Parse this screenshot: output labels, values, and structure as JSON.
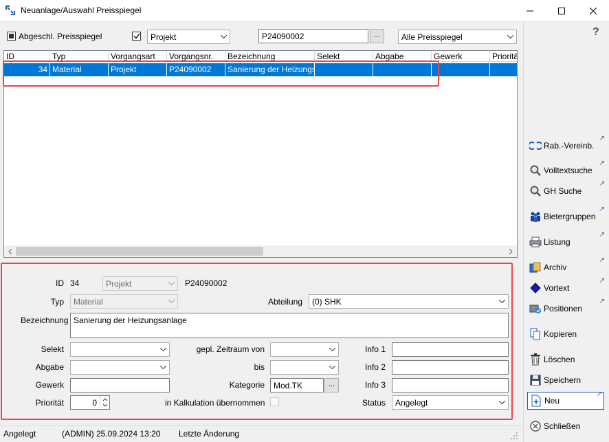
{
  "window": {
    "title": "Neuanlage/Auswahl Preisspiegel"
  },
  "toolbar": {
    "closed_checkbox_label": "Abgeschl. Preisspiegel",
    "type_combo": "Projekt",
    "search_value": "P24090002",
    "dots_label": "...",
    "filter_combo": "Alle Preisspiegel",
    "help_label": "?"
  },
  "grid": {
    "columns": [
      "ID",
      "Typ",
      "Vorgangsart",
      "Vorgangsnr.",
      "Bezeichnung",
      "Selekt",
      "Abgabe",
      "Gewerk",
      "Prioritä"
    ],
    "rows": [
      {
        "id": "34",
        "typ": "Material",
        "vorgangsart": "Projekt",
        "vorgangsnr": "P24090002",
        "bezeichnung": "Sanierung der Heizungsa",
        "selekt": "",
        "abgabe": "",
        "gewerk": "",
        "prioritaet": ""
      }
    ]
  },
  "form": {
    "id_label": "ID",
    "id_value": "34",
    "vorgangsart": "Projekt",
    "vorgangsnr": "P24090002",
    "typ_label": "Typ",
    "typ_value": "Material",
    "abteilung_label": "Abteilung",
    "abteilung_value": "(0) SHK",
    "bezeichnung_label": "Bezeichnung",
    "bezeichnung_value": "Sanierung der Heizungsanlage",
    "selekt_label": "Selekt",
    "abgabe_label": "Abgabe",
    "gewerk_label": "Gewerk",
    "prioritaet_label": "Priorität",
    "prioritaet_value": "0",
    "zeitraum_von_label": "gepl. Zeitraum von",
    "bis_label": "bis",
    "kategorie_label": "Kategorie",
    "kategorie_value": "Mod.TK",
    "kalkulation_label": "in Kalkulation übernommen",
    "info1_label": "Info 1",
    "info2_label": "Info 2",
    "info3_label": "Info 3",
    "status_label": "Status",
    "status_value": "Angelegt"
  },
  "sidebar": {
    "items": [
      {
        "label": "Rab.-Vereinb.",
        "icon": "euro-icon"
      },
      {
        "label": "Volltextsuche",
        "icon": "magnifier-icon"
      },
      {
        "label": "GH Suche",
        "icon": "magnifier-icon"
      },
      {
        "label": "Bietergruppen",
        "icon": "group-icon"
      },
      {
        "label": "Listung",
        "icon": "printer-icon"
      },
      {
        "label": "Archiv",
        "icon": "archive-icon"
      },
      {
        "label": "Vortext",
        "icon": "diamond-icon"
      },
      {
        "label": "Positionen",
        "icon": "folder-check-icon"
      },
      {
        "label": "Kopieren",
        "icon": "copy-icon"
      },
      {
        "label": "Löschen",
        "icon": "trash-icon"
      },
      {
        "label": "Speichern",
        "icon": "save-icon"
      },
      {
        "label": "Neu",
        "icon": "new-icon"
      },
      {
        "label": "Schließen",
        "icon": "close-circle-icon"
      }
    ]
  },
  "status": {
    "state": "Angelegt",
    "created": "(ADMIN) 25.09.2024 13:20",
    "last_change": "Letzte Änderung"
  },
  "colors": {
    "selection": "#0078d7",
    "highlight": "#e8474c"
  }
}
